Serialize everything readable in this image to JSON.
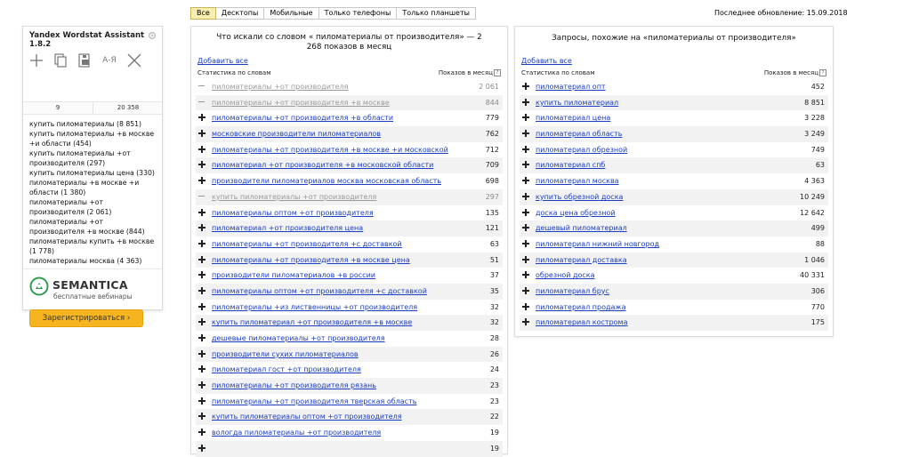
{
  "assistant": {
    "title": "Yandex Wordstat Assistant 1.8.2",
    "tools": [
      "add-icon",
      "copy-icon",
      "export-icon",
      "sort-az-icon",
      "clear-icon"
    ],
    "sort_label": "А-Я",
    "count_words": "9",
    "count_total": "20 358",
    "list": [
      "купить пиломатериалы (8 851)",
      "купить пиломатериалы +в москве +и области (454)",
      "купить пиломатериалы +от производителя (297)",
      "купить пиломатериалы цена (330)",
      "пиломатериалы +в москве +и области (1 380)",
      "пиломатериалы +от производителя (2 061)",
      "пиломатериалы +от производителя +в москве (844)",
      "пиломатериалы купить +в москве (1 778)",
      "пиломатериалы москва (4 363)"
    ],
    "brand": "SEMANTICA",
    "brand_sub": "бесплатные вебинары",
    "register_label": "Зарегистрироваться ›"
  },
  "tabs": [
    "Все",
    "Десктопы",
    "Мобильные",
    "Только телефоны",
    "Только планшеты"
  ],
  "last_update": "Последнее обновление: 15.09.2018",
  "left_panel": {
    "heading": "Что искали со словом « пиломатериалы от производителя» — 2 268 показов в месяц",
    "add_all": "Добавить все",
    "col_left": "Статистика по словам",
    "col_right": "Показов в месяц",
    "rows": [
      {
        "kw": "пиломатериалы +от производителя",
        "n": "2 061",
        "added": true
      },
      {
        "kw": "пиломатериалы +от производителя +в москве",
        "n": "844",
        "added": true
      },
      {
        "kw": "пиломатериалы +от производителя +в области",
        "n": "779",
        "added": false
      },
      {
        "kw": "московские производители пиломатериалов",
        "n": "762",
        "added": false
      },
      {
        "kw": "пиломатериалы +от производителя +в москве +и московской",
        "n": "712",
        "added": false
      },
      {
        "kw": "пиломатериал +от производителя +в московской области",
        "n": "709",
        "added": false
      },
      {
        "kw": "производители пиломатериалов москва московская область",
        "n": "698",
        "added": false
      },
      {
        "kw": "купить пиломатериалы +от производителя",
        "n": "297",
        "added": true
      },
      {
        "kw": "пиломатериалы оптом +от производителя",
        "n": "135",
        "added": false
      },
      {
        "kw": "пиломатериал +от производителя цена",
        "n": "121",
        "added": false
      },
      {
        "kw": "пиломатериалы +от производителя +с доставкой",
        "n": "63",
        "added": false
      },
      {
        "kw": "пиломатериалы +от производителя +в москве цена",
        "n": "51",
        "added": false
      },
      {
        "kw": "производители пиломатериалов +в россии",
        "n": "37",
        "added": false
      },
      {
        "kw": "пиломатериалы оптом +от производителя +с доставкой",
        "n": "35",
        "added": false
      },
      {
        "kw": "пиломатериалы +из лиственницы +от производителя",
        "n": "32",
        "added": false
      },
      {
        "kw": "купить пиломатериал +от производителя +в москве",
        "n": "32",
        "added": false
      },
      {
        "kw": "дешевые пиломатериалы +от производителя",
        "n": "28",
        "added": false
      },
      {
        "kw": "производители сухих пиломатериалов",
        "n": "26",
        "added": false
      },
      {
        "kw": "пиломатериал гост +от производителя",
        "n": "24",
        "added": false
      },
      {
        "kw": "пиломатериалы +от производителя рязань",
        "n": "23",
        "added": false
      },
      {
        "kw": "пиломатериалы +от производителя тверская область",
        "n": "23",
        "added": false
      },
      {
        "kw": "купить пиломатериалы оптом +от производителя",
        "n": "22",
        "added": false
      },
      {
        "kw": "вологда пиломатериалы +от производителя",
        "n": "19",
        "added": false
      },
      {
        "kw": "",
        "n": "19",
        "added": false
      }
    ]
  },
  "right_panel": {
    "heading": "Запросы, похожие на «пиломатериалы от производителя»",
    "add_all": "Добавить все",
    "col_left": "Статистика по словам",
    "col_right": "Показов в месяц",
    "rows": [
      {
        "kw": "пиломатериал опт",
        "n": "452",
        "added": false
      },
      {
        "kw": "купить пиломатериал",
        "n": "8 851",
        "added": false
      },
      {
        "kw": "пиломатериал цена",
        "n": "3 228",
        "added": false
      },
      {
        "kw": "пиломатериал область",
        "n": "3 249",
        "added": false
      },
      {
        "kw": "пиломатериал обрезной",
        "n": "749",
        "added": false
      },
      {
        "kw": "пиломатериал спб",
        "n": "63",
        "added": false
      },
      {
        "kw": "пиломатериал москва",
        "n": "4 363",
        "added": false
      },
      {
        "kw": "купить обрезной доска",
        "n": "10 249",
        "added": false
      },
      {
        "kw": "доска цена обрезной",
        "n": "12 642",
        "added": false
      },
      {
        "kw": "дешевый пиломатериал",
        "n": "499",
        "added": false
      },
      {
        "kw": "пиломатериал нижний новгород",
        "n": "88",
        "added": false
      },
      {
        "kw": "пиломатериал доставка",
        "n": "1 046",
        "added": false
      },
      {
        "kw": "обрезной доска",
        "n": "40 331",
        "added": false
      },
      {
        "kw": "пиломатериал брус",
        "n": "306",
        "added": false
      },
      {
        "kw": "пиломатериал продажа",
        "n": "770",
        "added": false
      },
      {
        "kw": "пиломатериал кострома",
        "n": "175",
        "added": false
      }
    ]
  }
}
